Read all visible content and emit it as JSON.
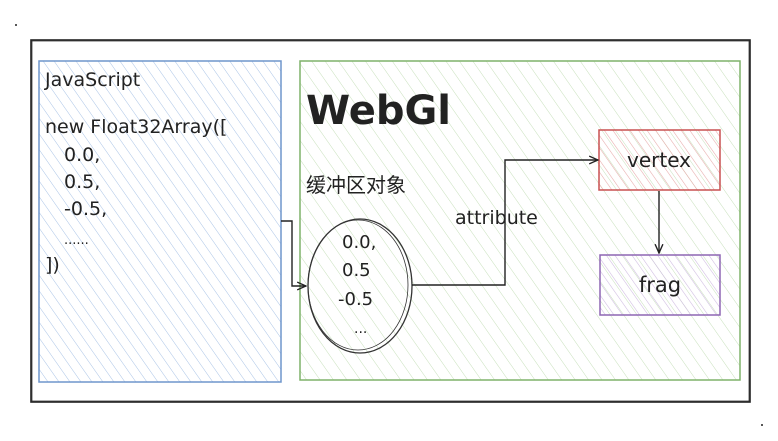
{
  "js_panel": {
    "title": "JavaScript",
    "code_lines": [
      "new Float32Array([",
      "0.0,",
      "0.5,",
      "-0.5,",
      "......",
      "])"
    ]
  },
  "webgl_panel": {
    "title": "WebGl",
    "buffer_label": "缓冲区对象",
    "buffer_values": [
      "0.0,",
      "0.5",
      "-0.5",
      "..."
    ],
    "link_label": "attribute",
    "vertex_label": "vertex",
    "frag_label": "frag"
  },
  "colors": {
    "js_border": "#6f95cc",
    "webgl_border": "#7fb26a",
    "vertex_border": "#c95050",
    "vertex_fill": "#f3d7d7",
    "frag_border": "#8d66b3",
    "frag_fill": "#e9e0f2"
  }
}
